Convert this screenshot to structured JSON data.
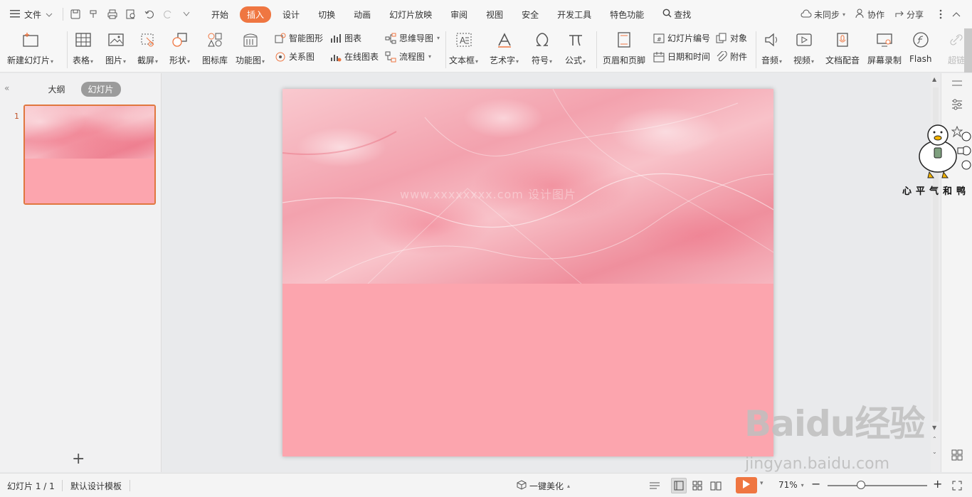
{
  "menubar": {
    "file_label": "文件",
    "tabs": [
      "开始",
      "插入",
      "设计",
      "切换",
      "动画",
      "幻灯片放映",
      "审阅",
      "视图",
      "安全",
      "开发工具",
      "特色功能"
    ],
    "active_tab": "插入",
    "search_label": "查找",
    "sync_label": "未同步",
    "collab_label": "协作",
    "share_label": "分享"
  },
  "ribbon": {
    "new_slide": "新建幻灯片",
    "table": "表格",
    "picture": "图片",
    "screenshot": "截屏",
    "shape": "形状",
    "icon_lib": "图标库",
    "function_chart": "功能图",
    "smart_shape": "智能图形",
    "chart": "图表",
    "relation_chart": "关系图",
    "online_chart": "在线图表",
    "mindmap": "思维导图",
    "flowchart": "流程图",
    "textbox": "文本框",
    "wordart": "艺术字",
    "symbol": "符号",
    "formula": "公式",
    "header_footer": "页眉和页脚",
    "slide_number": "幻灯片编号",
    "object": "对象",
    "datetime": "日期和时间",
    "attachment": "附件",
    "audio": "音频",
    "video": "视频",
    "voiceover": "文档配音",
    "screen_record": "屏幕录制",
    "flash": "Flash",
    "hyperlink": "超链"
  },
  "left_panel": {
    "tab_outline": "大纲",
    "tab_slides": "幻灯片",
    "slide_number": "1",
    "add_label": "+"
  },
  "sticker": {
    "caption": "心平气和鸭"
  },
  "statusbar": {
    "slide_info": "幻灯片 1 / 1",
    "template": "默认设计模板",
    "beautify": "一键美化",
    "zoom": "71%"
  },
  "watermark": {
    "brand": "Baidu经验",
    "url": "jingyan.baidu.com",
    "faint": "www.xxxxxxxx.com 设计图片"
  },
  "colors": {
    "accent": "#ef7641",
    "slide_pink": "#fca5ae",
    "thumb_border": "#e0773f"
  }
}
